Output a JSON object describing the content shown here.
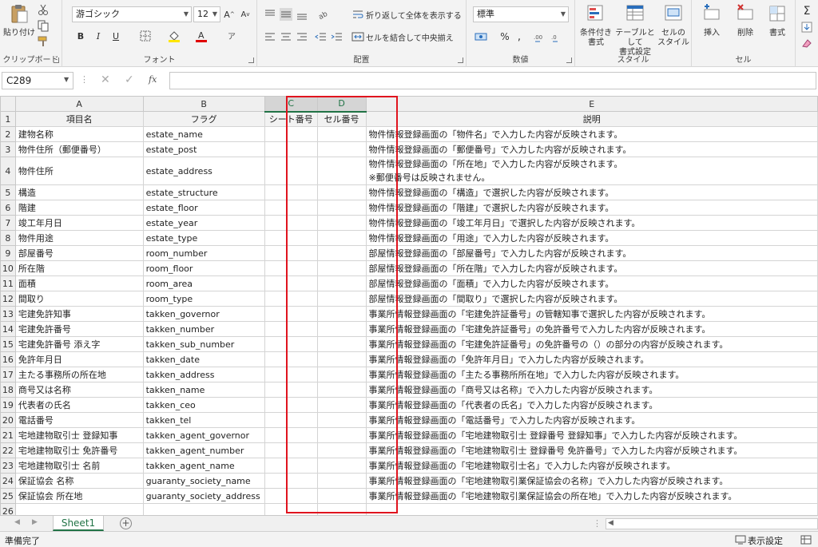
{
  "ribbon": {
    "clipboard": {
      "paste_label": "貼り付け",
      "group_label": "クリップボード"
    },
    "font": {
      "font_name": "游ゴシック",
      "font_size": "12",
      "group_label": "フォント",
      "bold": "B",
      "italic": "I",
      "underline": "U"
    },
    "alignment": {
      "wrap_text": "折り返して全体を表示する",
      "merge_center": "セルを結合して中央揃え",
      "group_label": "配置"
    },
    "number": {
      "format": "標準",
      "percent": "%",
      "comma": ",",
      "group_label": "数値"
    },
    "styles": {
      "conditional_line1": "条件付き",
      "conditional_line2": "書式",
      "table_line1": "テーブルとして",
      "table_line2": "書式設定",
      "cellstyle_line1": "セルの",
      "cellstyle_line2": "スタイル",
      "group_label": "スタイル"
    },
    "cells": {
      "insert": "挿入",
      "delete": "削除",
      "format": "書式",
      "group_label": "セル"
    }
  },
  "formula_bar": {
    "name_box": "C289",
    "fx": "fx",
    "content": ""
  },
  "columns": [
    "A",
    "B",
    "C",
    "D",
    "E"
  ],
  "header_row": {
    "num": "1",
    "cells": [
      "項目名",
      "フラグ",
      "シート番号",
      "セル番号",
      "説明"
    ]
  },
  "rows": [
    {
      "num": "2",
      "a": "建物名称",
      "b": "estate_name",
      "e": "物件情報登録画面の「物件名」で入力した内容が反映されます。"
    },
    {
      "num": "3",
      "a": "物件住所（郵便番号）",
      "b": "estate_post",
      "e": "物件情報登録画面の「郵便番号」で入力した内容が反映されます。"
    },
    {
      "num": "4",
      "a": "物件住所",
      "b": "estate_address",
      "e": "物件情報登録画面の「所在地」で入力した内容が反映されます。",
      "e2": "※郵便番号は反映されません。"
    },
    {
      "num": "5",
      "a": "構造",
      "b": "estate_structure",
      "e": "物件情報登録画面の「構造」で選択した内容が反映されます。"
    },
    {
      "num": "6",
      "a": "階建",
      "b": "estate_floor",
      "e": "物件情報登録画面の「階建」で選択した内容が反映されます。"
    },
    {
      "num": "7",
      "a": "竣工年月日",
      "b": "estate_year",
      "e": "物件情報登録画面の「竣工年月日」で選択した内容が反映されます。"
    },
    {
      "num": "8",
      "a": "物件用途",
      "b": "estate_type",
      "e": "物件情報登録画面の「用途」で入力した内容が反映されます。"
    },
    {
      "num": "9",
      "a": "部屋番号",
      "b": "room_number",
      "e": "部屋情報登録画面の「部屋番号」で入力した内容が反映されます。"
    },
    {
      "num": "10",
      "a": "所在階",
      "b": "room_floor",
      "e": "部屋情報登録画面の「所在階」で入力した内容が反映されます。"
    },
    {
      "num": "11",
      "a": "面積",
      "b": "room_area",
      "e": "部屋情報登録画面の「面積」で入力した内容が反映されます。"
    },
    {
      "num": "12",
      "a": "間取り",
      "b": "room_type",
      "e": "部屋情報登録画面の「間取り」で選択した内容が反映されます。"
    },
    {
      "num": "13",
      "a": "宅建免許知事",
      "b": "takken_governor",
      "e": "事業所情報登録画面の「宅建免許証番号」の管轄知事で選択した内容が反映されます。"
    },
    {
      "num": "14",
      "a": "宅建免許番号",
      "b": "takken_number",
      "e": "事業所情報登録画面の「宅建免許証番号」の免許番号で入力した内容が反映されます。"
    },
    {
      "num": "15",
      "a": "宅建免許番号 添え字",
      "b": "takken_sub_number",
      "e": "事業所情報登録画面の「宅建免許証番号」の免許番号の（）の部分の内容が反映されます。"
    },
    {
      "num": "16",
      "a": "免許年月日",
      "b": "takken_date",
      "e": "事業所情報登録画面の「免許年月日」で入力した内容が反映されます。"
    },
    {
      "num": "17",
      "a": "主たる事務所の所在地",
      "b": "takken_address",
      "e": "事業所情報登録画面の「主たる事務所所在地」で入力した内容が反映されます。"
    },
    {
      "num": "18",
      "a": "商号又は名称",
      "b": "takken_name",
      "e": "事業所情報登録画面の「商号又は名称」で入力した内容が反映されます。"
    },
    {
      "num": "19",
      "a": "代表者の氏名",
      "b": "takken_ceo",
      "e": "事業所情報登録画面の「代表者の氏名」で入力した内容が反映されます。"
    },
    {
      "num": "20",
      "a": "電話番号",
      "b": "takken_tel",
      "e": "事業所情報登録画面の「電話番号」で入力した内容が反映されます。"
    },
    {
      "num": "21",
      "a": "宅地建物取引士 登録知事",
      "b": "takken_agent_governor",
      "e": "事業所情報登録画面の「宅地建物取引士 登録番号 登録知事」で入力した内容が反映されます。"
    },
    {
      "num": "22",
      "a": "宅地建物取引士 免許番号",
      "b": "takken_agent_number",
      "e": "事業所情報登録画面の「宅地建物取引士 登録番号 免許番号」で入力した内容が反映されます。"
    },
    {
      "num": "23",
      "a": "宅地建物取引士 名前",
      "b": "takken_agent_name",
      "e": "事業所情報登録画面の「宅地建物取引士名」で入力した内容が反映されます。"
    },
    {
      "num": "24",
      "a": "保証協会 名称",
      "b": "guaranty_society_name",
      "e": "事業所情報登録画面の「宅地建物取引業保証協会の名称」で入力した内容が反映されます。"
    },
    {
      "num": "25",
      "a": "保証協会 所在地",
      "b": "guaranty_society_address",
      "e": "事業所情報登録画面の「宅地建物取引業保証協会の所在地」で入力した内容が反映されます。"
    },
    {
      "num": "26",
      "a": "",
      "b": "",
      "e": ""
    }
  ],
  "sheet_tab": "Sheet1",
  "status": {
    "ready": "準備完了",
    "display_settings": "表示設定"
  },
  "colors": {
    "accent": "#217346",
    "highlight_box": "#e0141e"
  }
}
